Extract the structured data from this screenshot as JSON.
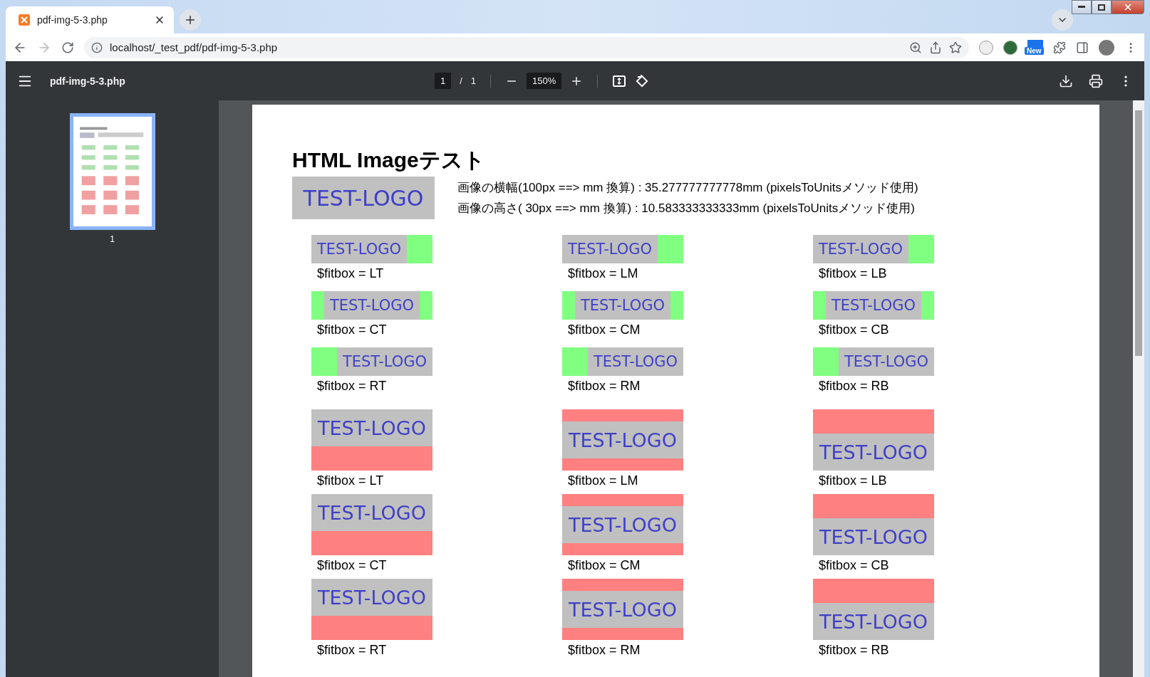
{
  "browser": {
    "tab_title": "pdf-img-5-3.php",
    "address": "localhost/_test_pdf/pdf-img-5-3.php",
    "extension_badge": "New"
  },
  "viewer": {
    "title": "pdf-img-5-3.php",
    "page": "1",
    "separator": "/",
    "total_pages": "1",
    "zoom": "150%",
    "thumbnail_label": "1"
  },
  "document": {
    "heading": "HTML Imageテスト",
    "header_logo": "TEST-LOGO",
    "info_lines": [
      "画像の横幅(100px ==> mm 換算) : 35.277777777778mm (pixelsToUnitsメソッド使用)",
      "画像の高さ( 30px ==> mm 換算) : 10.583333333333mm (pixelsToUnitsメソッド使用)"
    ],
    "groups": [
      {
        "color": "#80ff80",
        "kind": "horizontal",
        "cells": [
          {
            "logo": "TEST-LOGO",
            "label": "$fitbox = LT",
            "kind": "start"
          },
          {
            "logo": "TEST-LOGO",
            "label": "$fitbox = LM",
            "kind": "start"
          },
          {
            "logo": "TEST-LOGO",
            "label": "$fitbox = LB",
            "kind": "start"
          },
          {
            "logo": "TEST-LOGO",
            "label": "$fitbox = CT",
            "kind": "center"
          },
          {
            "logo": "TEST-LOGO",
            "label": "$fitbox = CM",
            "kind": "center"
          },
          {
            "logo": "TEST-LOGO",
            "label": "$fitbox = CB",
            "kind": "center"
          },
          {
            "logo": "TEST-LOGO",
            "label": "$fitbox = RT",
            "kind": "end"
          },
          {
            "logo": "TEST-LOGO",
            "label": "$fitbox = RM",
            "kind": "end"
          },
          {
            "logo": "TEST-LOGO",
            "label": "$fitbox = RB",
            "kind": "end"
          }
        ]
      },
      {
        "color": "#ff8080",
        "kind": "vertical",
        "cells": [
          {
            "logo": "TEST-LOGO",
            "label": "$fitbox = LT",
            "kind": "start"
          },
          {
            "logo": "TEST-LOGO",
            "label": "$fitbox = LM",
            "kind": "center"
          },
          {
            "logo": "TEST-LOGO",
            "label": "$fitbox = LB",
            "kind": "end"
          },
          {
            "logo": "TEST-LOGO",
            "label": "$fitbox = CT",
            "kind": "start"
          },
          {
            "logo": "TEST-LOGO",
            "label": "$fitbox = CM",
            "kind": "center"
          },
          {
            "logo": "TEST-LOGO",
            "label": "$fitbox = CB",
            "kind": "end"
          },
          {
            "logo": "TEST-LOGO",
            "label": "$fitbox = RT",
            "kind": "start"
          },
          {
            "logo": "TEST-LOGO",
            "label": "$fitbox = RM",
            "kind": "center"
          },
          {
            "logo": "TEST-LOGO",
            "label": "$fitbox = RB",
            "kind": "end"
          }
        ]
      }
    ]
  }
}
